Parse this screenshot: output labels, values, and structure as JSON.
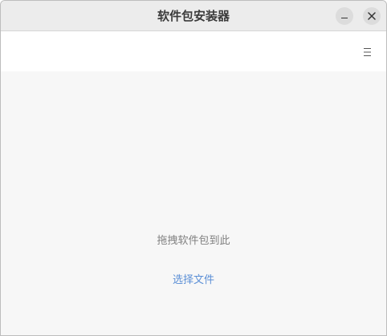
{
  "window": {
    "title": "软件包安装器"
  },
  "titlebar": {
    "minimize_icon": "minimize-icon",
    "close_icon": "close-icon"
  },
  "toolbar": {
    "menu_icon": "hamburger-menu-icon"
  },
  "content": {
    "drop_hint": "拖拽软件包到此",
    "select_file_label": "选择文件"
  },
  "colors": {
    "link": "#5b8fd6",
    "hint_text": "#808080",
    "content_bg": "#f7f7f7"
  }
}
